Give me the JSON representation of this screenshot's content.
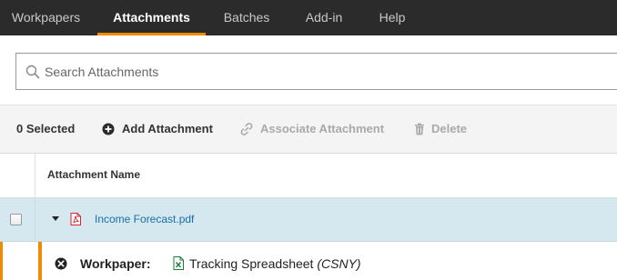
{
  "nav": {
    "tabs": [
      {
        "label": "Workpapers",
        "active": false
      },
      {
        "label": "Attachments",
        "active": true
      },
      {
        "label": "Batches",
        "active": false
      },
      {
        "label": "Add-in",
        "active": false
      },
      {
        "label": "Help",
        "active": false
      }
    ]
  },
  "search": {
    "placeholder": "Search Attachments",
    "value": "",
    "icon": "search-icon"
  },
  "toolbar": {
    "selected_label": "0 Selected",
    "add_label": "Add Attachment",
    "associate_label": "Associate Attachment",
    "delete_label": "Delete"
  },
  "table": {
    "column_header": "Attachment Name",
    "rows": [
      {
        "file_name": "Income Forecast.pdf",
        "file_type": "pdf",
        "checked": false,
        "expanded": true,
        "children": [
          {
            "label": "Workpaper:",
            "name": "Tracking Spreadsheet",
            "code": "(CSNY)",
            "file_type": "spreadsheet"
          }
        ]
      }
    ]
  },
  "colors": {
    "nav_bg": "#2b2b2b",
    "accent": "#f18a00",
    "row_selected_bg": "#d5e8f0",
    "link": "#1b6da2",
    "pdf_red": "#d9262b",
    "xls_green": "#1e7b3c"
  }
}
